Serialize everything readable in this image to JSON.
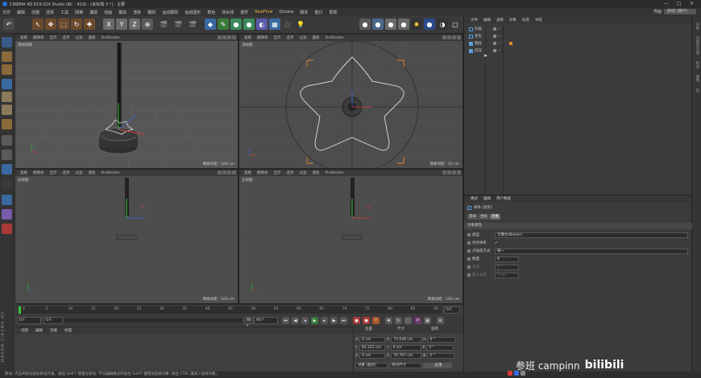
{
  "window": {
    "title": "CINEMA 4D R19.024 Studio (RC - R19) - [未标题 3 *] - 主要"
  },
  "menu": {
    "items": [
      "文件",
      "编辑",
      "创建",
      "选择",
      "工具",
      "网格",
      "捕捉",
      "动画",
      "模拟",
      "渲染",
      "雕刻",
      "运动跟踪",
      "运动图形",
      "角色",
      "流水线",
      "插件",
      "RealFlow",
      "Octane",
      "脚本",
      "窗口",
      "帮助"
    ],
    "highlight_index": 16,
    "layout_label": "界面",
    "layout_value": "启动 (用户)"
  },
  "viewports": [
    {
      "header": [
        "查看",
        "摄像机",
        "显示",
        "选项",
        "过滤",
        "面板",
        "ProRender"
      ],
      "name": "透视视图",
      "grid": "网格间距 : 100 cm"
    },
    {
      "header": [
        "查看",
        "摄像机",
        "显示",
        "选项",
        "过滤",
        "面板",
        "ProRender"
      ],
      "name": "顶视图",
      "grid": "网格间距 : 10 cm"
    },
    {
      "header": [
        "查看",
        "摄像机",
        "显示",
        "选项",
        "过滤",
        "面板",
        "ProRender"
      ],
      "name": "右视图",
      "grid": "网格间距 : 100 cm"
    },
    {
      "header": [
        "查看",
        "摄像机",
        "显示",
        "选项",
        "过滤",
        "面板",
        "ProRender"
      ],
      "name": "正视图",
      "grid": "网格间距 : 100 cm"
    }
  ],
  "timeline": {
    "ticks": [
      "0",
      "5",
      "10",
      "15",
      "20",
      "25",
      "30",
      "35",
      "40",
      "45",
      "50",
      "55",
      "60",
      "65",
      "70",
      "75",
      "80",
      "85",
      "90"
    ],
    "end_field": "0 F"
  },
  "playback": {
    "start": "0 F",
    "current": "0 F",
    "end_a": "90 F",
    "end_b": "90 F"
  },
  "materials": {
    "tabs": [
      "创建",
      "编辑",
      "功能",
      "纹理"
    ]
  },
  "coords": {
    "headers": [
      "位置",
      "尺寸",
      "旋转"
    ],
    "rows": [
      {
        "axis": "X",
        "pos": "0 cm",
        "size_axis": "X",
        "size": "73.038 cm",
        "rot_axis": "H",
        "rot": "0 °"
      },
      {
        "axis": "Y",
        "pos": "65.322 cm",
        "size_axis": "Y",
        "size": "0 cm",
        "rot_axis": "P",
        "rot": "0 °"
      },
      {
        "axis": "Z",
        "pos": "0 cm",
        "size_axis": "Z",
        "size": "76.797 cm",
        "rot_axis": "B",
        "rot": "0 °"
      }
    ],
    "mode_a": "对象 (相对)",
    "mode_b": "绝对尺寸",
    "apply": "应用"
  },
  "objects": {
    "tabs": [
      "文件",
      "编辑",
      "查看",
      "对象",
      "标签",
      "书签"
    ],
    "items": [
      {
        "label": "扫描",
        "color": "#5aa0e0"
      },
      {
        "label": "星形",
        "color": "#5aa0e0"
      },
      {
        "label": "圆柱",
        "color": "#5aa0e0"
      },
      {
        "label": "挤压",
        "color": "#5aa0e0"
      }
    ]
  },
  "attributes": {
    "tabs": [
      "模式",
      "编辑",
      "用户数据"
    ],
    "object_label": "样条 [星形]",
    "subtabs": [
      "基本",
      "坐标",
      "对象"
    ],
    "active_subtab": 2,
    "section": "对象属性",
    "rows": [
      {
        "label": "类型",
        "value": "贝塞尔(Bezier)"
      },
      {
        "label": "闭合样条",
        "value": "✓"
      },
      {
        "label": "点插值方式",
        "value": "统一"
      },
      {
        "label": "数量",
        "value": "8"
      },
      {
        "label": "角度",
        "value": "5 °"
      },
      {
        "label": "最大长度",
        "value": "5 cm"
      }
    ]
  },
  "statusbar": {
    "text": "移动: 点击并拖动鼠标移动元素。按住 SHIFT 键量化移动; 节点编辑模式时按住 SHIFT 键增加选择对象; 按住 CTRL 键减少选择对象。"
  },
  "rightstrip": [
    "对象",
    "内容浏览器",
    "构造",
    "属性",
    "层"
  ],
  "watermark": {
    "text": "参班 campinn",
    "brand": "bilibili"
  },
  "branding": {
    "vertical": "MAXON CINEMA 4D"
  }
}
